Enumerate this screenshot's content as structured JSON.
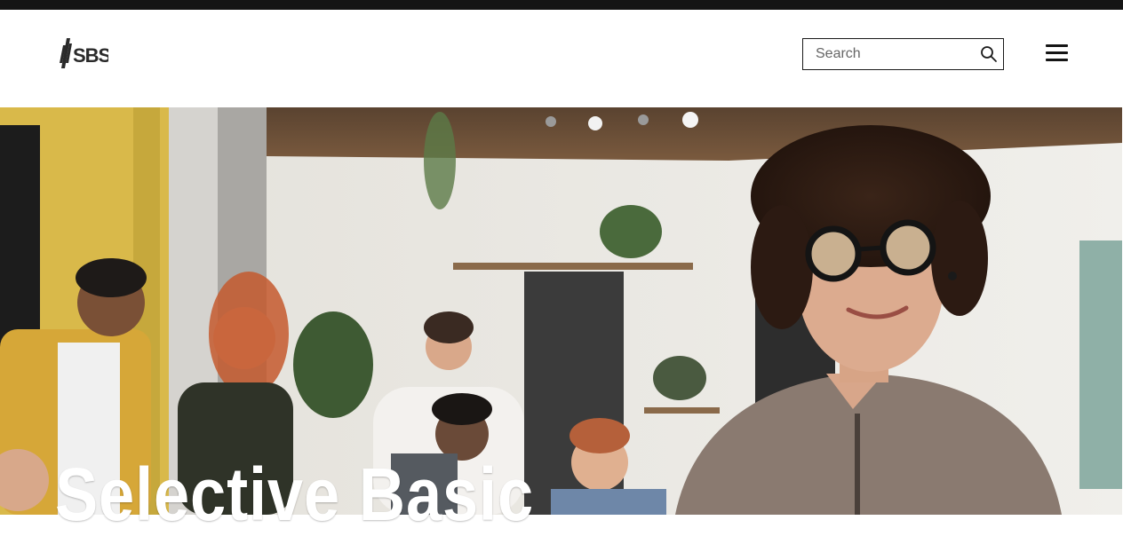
{
  "header": {
    "logo_text": "SBS",
    "search": {
      "placeholder": "Search",
      "value": ""
    },
    "search_icon": "magnifier-icon",
    "menu_icon": "hamburger-icon"
  },
  "hero": {
    "title": "Selective Basic",
    "image": "photo of a smiling woman with curly hair and glasses in an office, colleagues blurred in background"
  },
  "colors": {
    "topbar": "#151515",
    "header_bg": "#ffffff",
    "title_text": "#ffffff"
  }
}
